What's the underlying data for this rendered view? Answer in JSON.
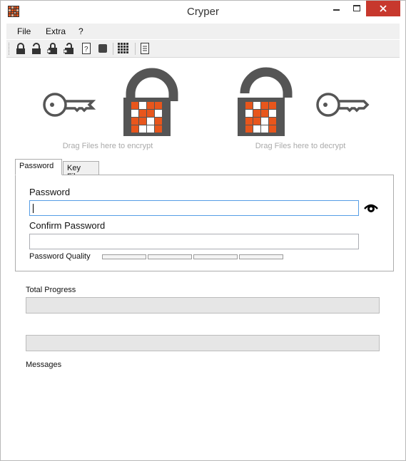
{
  "window": {
    "title": "Cryper"
  },
  "menu": {
    "items": [
      "File",
      "Extra",
      "?"
    ]
  },
  "toolbar": {
    "buttons": [
      "lock-icon",
      "unlock-icon",
      "lock-files-icon",
      "unlock-files-icon",
      "help-icon",
      "stop-icon",
      "grid-icon",
      "document-icon"
    ]
  },
  "dropzones": {
    "encrypt_text": "Drag Files here to encrypt",
    "decrypt_text": "Drag Files here to decrypt"
  },
  "tabs": [
    {
      "label": "Password",
      "active": true
    },
    {
      "label": "Key File",
      "active": false
    }
  ],
  "password_form": {
    "password_label": "Password",
    "password_value": "",
    "confirm_label": "Confirm Password",
    "confirm_value": "",
    "quality_label": "Password Quality",
    "quality_segments": 4,
    "quality_level": 0
  },
  "progress": {
    "total_label": "Total Progress",
    "total_value": 0,
    "file_value": 0
  },
  "messages": {
    "label": "Messages",
    "items": []
  },
  "colors": {
    "accent_orange": "#e8561c",
    "lock_gray": "#555555",
    "close_red": "#c7382d",
    "focus_blue": "#569de5"
  }
}
